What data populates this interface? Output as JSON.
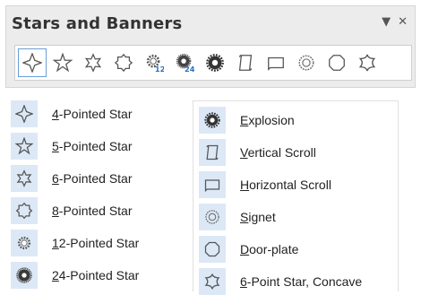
{
  "toolbar": {
    "title": "Stars and Banners",
    "dropdown_glyph": "▼",
    "close_glyph": "✕",
    "buttons": [
      {
        "icon": "4-pointed-star-icon"
      },
      {
        "icon": "5-pointed-star-icon"
      },
      {
        "icon": "6-pointed-star-icon"
      },
      {
        "icon": "8-pointed-star-icon"
      },
      {
        "icon": "12-pointed-star-icon",
        "badge": "12"
      },
      {
        "icon": "24-pointed-star-icon",
        "badge": "24"
      },
      {
        "icon": "explosion-icon"
      },
      {
        "icon": "vertical-scroll-icon"
      },
      {
        "icon": "horizontal-scroll-icon"
      },
      {
        "icon": "signet-icon"
      },
      {
        "icon": "door-plate-icon"
      },
      {
        "icon": "6-point-star-concave-icon"
      }
    ]
  },
  "menu_left": [
    {
      "mnemonic": "4",
      "rest": "-Pointed Star",
      "icon": "4-pointed-star-icon"
    },
    {
      "mnemonic": "5",
      "rest": "-Pointed Star",
      "icon": "5-pointed-star-icon"
    },
    {
      "mnemonic": "6",
      "rest": "-Pointed Star",
      "icon": "6-pointed-star-icon"
    },
    {
      "mnemonic": "8",
      "rest": "-Pointed Star",
      "icon": "8-pointed-star-icon"
    },
    {
      "mnemonic": "1",
      "rest": "2-Pointed Star",
      "icon": "12-pointed-star-icon"
    },
    {
      "mnemonic": "2",
      "rest": "4-Pointed Star",
      "icon": "24-pointed-star-icon"
    }
  ],
  "menu_right": [
    {
      "mnemonic": "E",
      "rest": "xplosion",
      "icon": "explosion-icon"
    },
    {
      "mnemonic": "V",
      "rest": "ertical Scroll",
      "icon": "vertical-scroll-icon"
    },
    {
      "mnemonic": "H",
      "rest": "orizontal Scroll",
      "icon": "horizontal-scroll-icon"
    },
    {
      "mnemonic": "S",
      "rest": "ignet",
      "icon": "signet-icon"
    },
    {
      "mnemonic": "D",
      "rest": "oor-plate",
      "icon": "door-plate-icon"
    },
    {
      "mnemonic": "6",
      "rest": "-Point Star, Concave",
      "icon": "6-point-star-concave-icon"
    }
  ],
  "colors": {
    "selection": "#dce8f6",
    "icon_stroke": "#555555",
    "badge": "#2a6fbf"
  }
}
